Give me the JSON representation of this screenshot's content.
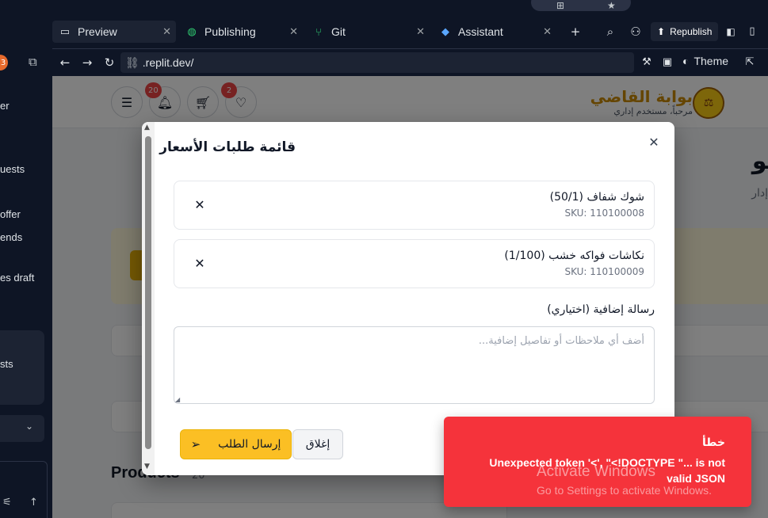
{
  "os": {
    "glyph_a": "⊞",
    "glyph_b": "★"
  },
  "sidebar": {
    "badge": "3",
    "items": [
      {
        "label": "er"
      },
      {
        "label": "uests"
      },
      {
        "label": "offer"
      },
      {
        "label": "ends"
      },
      {
        "label": "es draft"
      },
      {
        "label": "sts"
      }
    ]
  },
  "tabs": [
    {
      "label": "Preview",
      "icon": "monitor-icon"
    },
    {
      "label": "Publishing",
      "icon": "globe-icon"
    },
    {
      "label": "Git",
      "icon": "git-icon"
    },
    {
      "label": "Assistant",
      "icon": "assistant-icon"
    }
  ],
  "toolbar": {
    "republish_label": "Republish",
    "theme_label": "Theme"
  },
  "url": {
    "value": ".replit.dev/"
  },
  "site": {
    "brand_name": "بوابة القاضي",
    "brand_subtitle": "مرحباً، مستخدم إداري",
    "notifications_count": "20",
    "wishlist_count": "2",
    "page_title": "لو",
    "page_subtitle": "إدار",
    "products_heading": "Products",
    "products_count": "20"
  },
  "modal": {
    "title": "قائمة طلبات الأسعار",
    "items": [
      {
        "name": "شوك شفاف (50/1)",
        "sku": "SKU: 110100008"
      },
      {
        "name": "نكاشات فواكه خشب (1/100)",
        "sku": "SKU: 110100009"
      }
    ],
    "message_label": "رسالة إضافية (اختياري)",
    "message_placeholder": "أضف أي ملاحظات أو تفاصيل إضافية...",
    "send_label": "إرسال الطلب",
    "close_label": "إغلاق"
  },
  "toast": {
    "title": "خطأ",
    "message": "Unexpected token '<', \"<!DOCTYPE \"... is not valid JSON"
  },
  "watermark": {
    "line1": "Activate Windows",
    "line2": "Go to Settings to activate Windows."
  },
  "colors": {
    "ide_bg": "#0e1525",
    "accent_yellow": "#fbbf24",
    "toast_red": "#f5333b"
  }
}
